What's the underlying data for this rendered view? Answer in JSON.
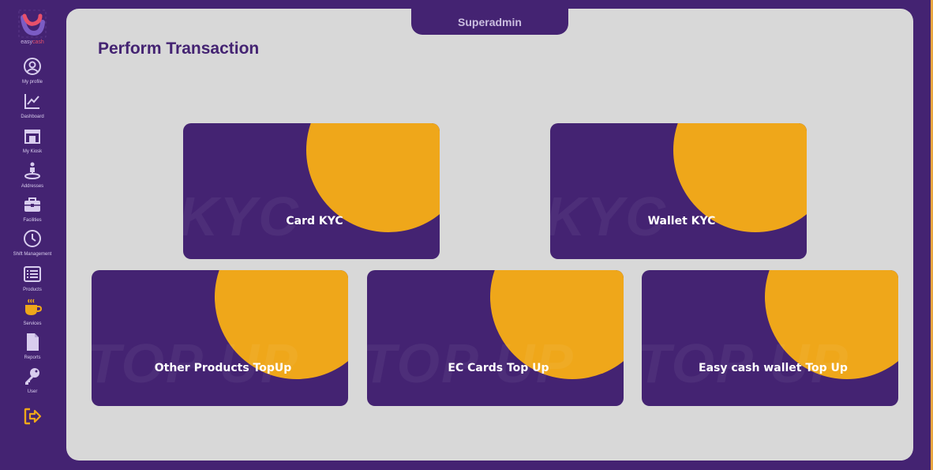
{
  "brand": {
    "logo_text_a": "easy",
    "logo_text_b": "cash"
  },
  "header": {
    "user_role": "Superadmin"
  },
  "page": {
    "title": "Perform Transaction"
  },
  "sidebar": {
    "items": [
      {
        "label": "My profile",
        "icon": "user-circle-icon"
      },
      {
        "label": "Dashboard",
        "icon": "line-chart-icon"
      },
      {
        "label": "My Kiosk",
        "icon": "store-icon"
      },
      {
        "label": "Addresses",
        "icon": "map-pin-person-icon"
      },
      {
        "label": "Facilities",
        "icon": "briefcase-icon"
      },
      {
        "label": "Shift Management",
        "icon": "clock-icon"
      },
      {
        "label": "Products",
        "icon": "list-icon"
      },
      {
        "label": "Services",
        "icon": "coffee-cup-icon"
      },
      {
        "label": "Reports",
        "icon": "document-icon"
      },
      {
        "label": "User",
        "icon": "key-icon"
      }
    ],
    "logout_icon": "logout-icon"
  },
  "cards": [
    {
      "label": "Card KYC",
      "watermark": "KYC"
    },
    {
      "label": "Wallet KYC",
      "watermark": "KYC"
    },
    {
      "label": "Other Products TopUp",
      "watermark": "TOP UP"
    },
    {
      "label": "EC Cards Top Up",
      "watermark": "TOP UP"
    },
    {
      "label": "Easy cash wallet Top Up",
      "watermark": "TOP UP"
    }
  ],
  "colors": {
    "brand_purple": "#442372",
    "accent_orange": "#efa71a",
    "panel_gray": "#d8d8d8"
  }
}
